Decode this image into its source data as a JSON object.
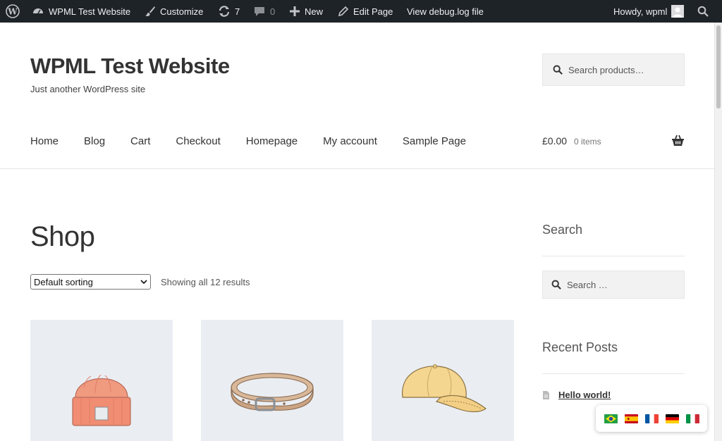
{
  "adminbar": {
    "site_name": "WPML Test Website",
    "customize": "Customize",
    "updates_count": "7",
    "comments_count": "0",
    "new_label": "New",
    "edit_page": "Edit Page",
    "debug_log": "View debug.log file",
    "howdy": "Howdy, wpml",
    "colors": {
      "background": "#1d2327",
      "text": "#f0f0f1"
    }
  },
  "header": {
    "site_title": "WPML Test Website",
    "tagline": "Just another WordPress site",
    "search_placeholder": "Search products…"
  },
  "nav": {
    "items": [
      "Home",
      "Blog",
      "Cart",
      "Checkout",
      "Homepage",
      "My account",
      "Sample Page"
    ]
  },
  "cart": {
    "amount": "£0.00",
    "count": "0 items"
  },
  "shop": {
    "title": "Shop",
    "sort_selected": "Default sorting",
    "results_text": "Showing all 12 results",
    "products": [
      {
        "image": "beanie-image"
      },
      {
        "image": "belt-image"
      },
      {
        "image": "cap-image"
      }
    ]
  },
  "sidebar": {
    "search_title": "Search",
    "search_placeholder": "Search …",
    "recent_posts_title": "Recent Posts",
    "recent_posts": [
      "Hello world!"
    ]
  },
  "language_switcher": {
    "flags": [
      "brazil-flag",
      "spain-flag",
      "france-flag",
      "germany-flag",
      "italy-flag"
    ]
  }
}
